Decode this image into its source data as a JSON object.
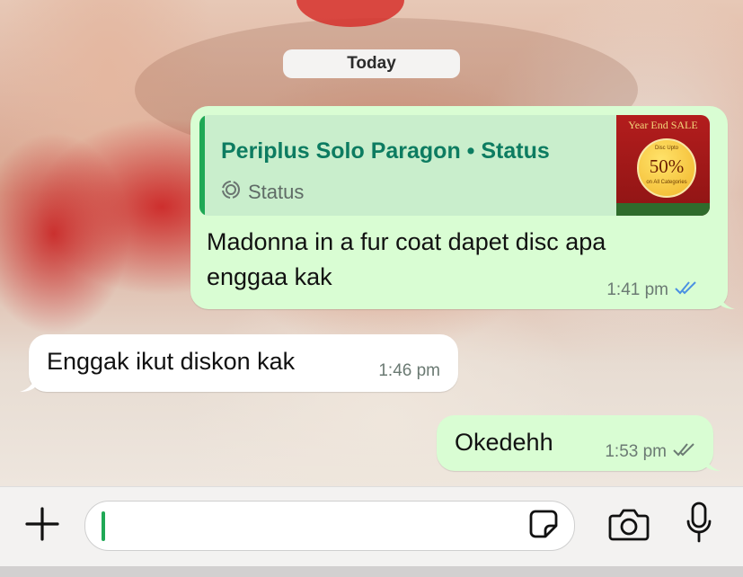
{
  "date_divider": "Today",
  "messages": [
    {
      "direction": "outgoing",
      "reply": {
        "title": "Periplus Solo Paragon • Status",
        "subtitle": "Status",
        "thumbnail": {
          "title": "Year End SALE",
          "small_top": "Disc Upto",
          "percent": "50%",
          "small_bottom": "on All Categories"
        }
      },
      "text_line1": "Madonna in a fur coat dapet disc apa",
      "text_line2": "enggaa kak",
      "time": "1:41 pm",
      "status": "read",
      "status_color": "#4a90e2"
    },
    {
      "direction": "incoming",
      "text": "Enggak ikut diskon kak",
      "time": "1:46 pm"
    },
    {
      "direction": "outgoing",
      "text": "Okedehh",
      "time": "1:53 pm",
      "status": "delivered",
      "status_color": "#6b7a73"
    }
  ],
  "composer": {
    "placeholder": "",
    "value": ""
  },
  "colors": {
    "outgoing_bubble": "#d9fdd3",
    "incoming_bubble": "#ffffff",
    "accent": "#1fa855",
    "quote_title": "#0d7c61"
  },
  "icons": [
    "plus-icon",
    "sticker-icon",
    "camera-icon",
    "microphone-icon",
    "status-ring-icon",
    "double-check-icon"
  ]
}
